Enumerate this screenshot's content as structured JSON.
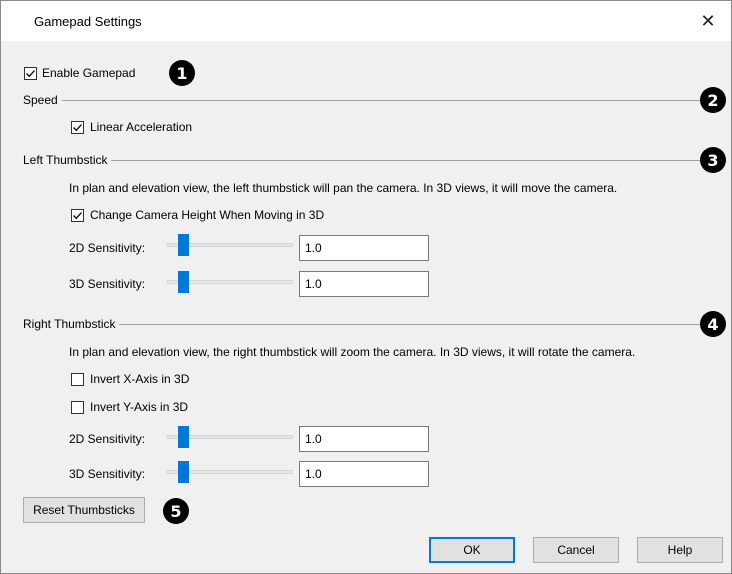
{
  "window": {
    "title": "Gamepad Settings",
    "close_glyph": "✕"
  },
  "enable_gamepad": {
    "label": "Enable Gamepad",
    "checked": true,
    "callout": "1"
  },
  "speed": {
    "section_label": "Speed",
    "callout": "2",
    "linear_acceleration": {
      "label": "Linear Acceleration",
      "checked": true
    }
  },
  "left_thumbstick": {
    "section_label": "Left Thumbstick",
    "callout": "3",
    "description": "In plan and elevation view, the left thumbstick will pan the camera. In 3D views, it will move the camera.",
    "change_camera_height": {
      "label": "Change Camera Height When Moving in 3D",
      "checked": true
    },
    "sensitivity_2d": {
      "label": "2D Sensitivity:",
      "value": "1.0"
    },
    "sensitivity_3d": {
      "label": "3D Sensitivity:",
      "value": "1.0"
    }
  },
  "right_thumbstick": {
    "section_label": "Right Thumbstick",
    "callout": "4",
    "description": "In plan and elevation view, the right thumbstick will zoom the camera. In 3D views, it will rotate the camera.",
    "invert_x": {
      "label": "Invert X-Axis in 3D",
      "checked": false
    },
    "invert_y": {
      "label": "Invert Y-Axis in 3D",
      "checked": false
    },
    "sensitivity_2d": {
      "label": "2D Sensitivity:",
      "value": "1.0"
    },
    "sensitivity_3d": {
      "label": "3D Sensitivity:",
      "value": "1.0"
    }
  },
  "reset": {
    "label": "Reset Thumbsticks",
    "callout": "5"
  },
  "footer": {
    "ok_label": "OK",
    "cancel_label": "Cancel",
    "help_label": "Help"
  },
  "colors": {
    "accent": "#0078d7",
    "dialog_bg": "#f0f0f0",
    "callout_bg": "#000000"
  }
}
